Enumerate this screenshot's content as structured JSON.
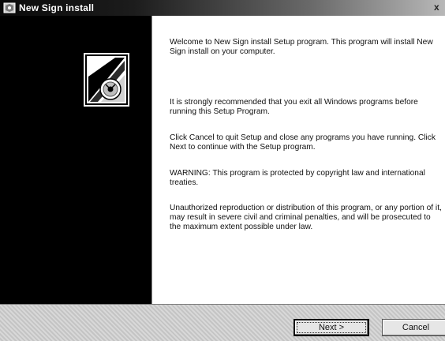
{
  "window": {
    "title": "New Sign install",
    "close_glyph": "x"
  },
  "logo": {
    "icon": "installer-disc-icon"
  },
  "content": {
    "paragraphs": [
      "Welcome to New Sign install Setup program. This program will install New Sign install on your computer.",
      "It is strongly recommended that you exit all Windows programs before running this Setup Program.",
      "Click Cancel to quit Setup and close any programs you have running.  Click Next to continue with the Setup program.",
      "WARNING: This program is protected by copyright law and international treaties.",
      "Unauthorized reproduction or distribution of this program, or any portion of it, may result in severe civil and criminal penalties, and will be prosecuted to the maximum extent possible under law."
    ]
  },
  "buttons": {
    "next": "Next >",
    "cancel": "Cancel"
  }
}
